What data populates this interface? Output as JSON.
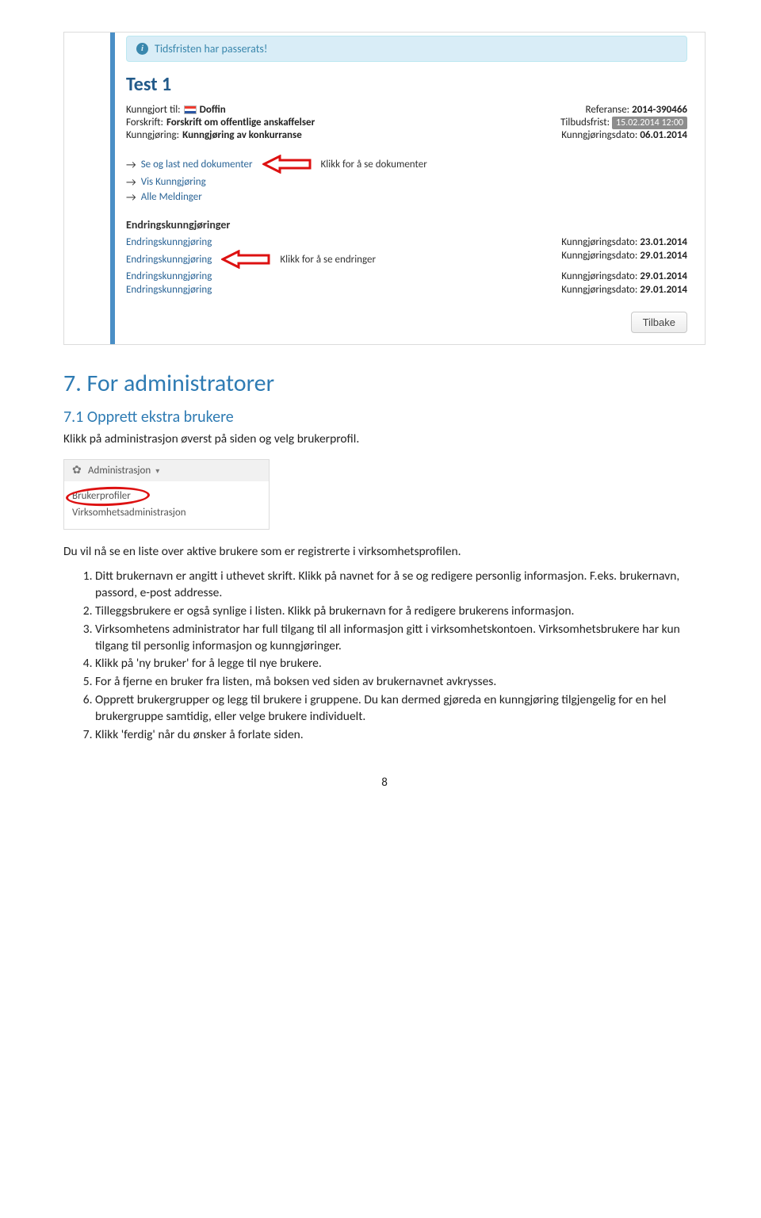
{
  "alert": {
    "text": "Tidsfristen har passerats!"
  },
  "test_title": "Test 1",
  "meta": {
    "published_lbl": "Kunngjort til:",
    "published_val": "Doffin",
    "regulation_lbl": "Forskrift:",
    "regulation_val": "Forskrift om offentlige anskaffelser",
    "notice_lbl": "Kunngjøring:",
    "notice_val": "Kunngjøring av konkurranse",
    "ref_lbl": "Referanse:",
    "ref_val": "2014-390466",
    "deadline_lbl": "Tilbudsfrist:",
    "deadline_val": "15.02.2014 12:00",
    "pubdate_lbl": "Kunngjøringsdato:",
    "pubdate_val": "06.01.2014"
  },
  "links": {
    "download": "Se og last ned dokumenter",
    "view": "Vis Kunngjøring",
    "msgs": "Alle Meldinger",
    "callout1": "Klikk for å se dokumenter",
    "callout2": "Klikk for å se endringer"
  },
  "changes": {
    "heading": "Endringskunngjøringer",
    "label": "Endringskunngjøring",
    "date_lbl": "Kunngjøringsdato:",
    "rows": [
      {
        "date": "23.01.2014"
      },
      {
        "date": "29.01.2014"
      },
      {
        "date": "29.01.2014"
      },
      {
        "date": "29.01.2014"
      }
    ]
  },
  "back_btn": "Tilbake",
  "doc": {
    "h_main": "7. For administratorer",
    "h_sub": "7.1 Opprett ekstra brukere",
    "p1": "Klikk på administrasjon øverst på siden og velg brukerprofil.",
    "admin_menu": {
      "title": "Administrasjon",
      "item1": "Brukerprofiler",
      "item2": "Virksomhetsadministrasjon"
    },
    "p2": "Du vil nå se en liste over aktive brukere som er registrerte i virksomhetsprofilen.",
    "list": [
      "Ditt brukernavn er angitt i uthevet skrift. Klikk på navnet for å se og redigere personlig informasjon. F.eks. brukernavn, passord, e-post addresse.",
      "Tilleggsbrukere er også synlige i listen. Klikk på brukernavn for å redigere brukerens informasjon.",
      "Virksomhetens administrator har full tilgang til all informasjon gitt i virksomhetskontoen. Virksomhetsbrukere har kun tilgang til personlig informasjon og kunngjøringer.",
      "Klikk på 'ny bruker' for å legge til nye brukere.",
      "For å fjerne en bruker fra listen, må boksen ved siden av brukernavnet avkrysses.",
      "Opprett brukergrupper og legg til brukere i gruppene. Du kan dermed gjøreda en kunngjøring tilgjengelig for en hel brukergruppe samtidig, eller velge brukere individuelt.",
      "Klikk 'ferdig' når du ønsker å forlate siden."
    ],
    "page_num": "8"
  }
}
